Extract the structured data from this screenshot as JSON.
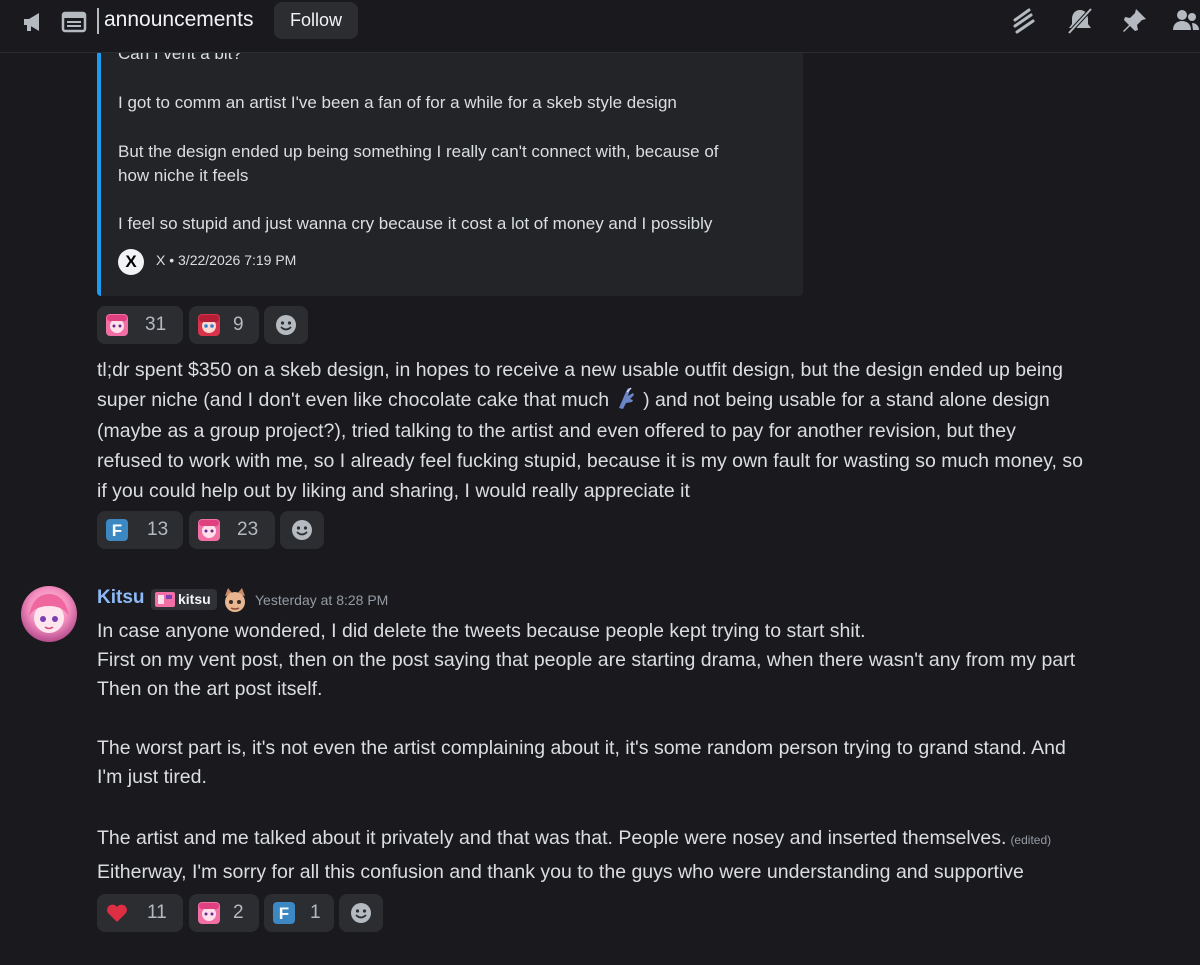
{
  "header": {
    "channel_name": "announcements",
    "follow_label": "Follow"
  },
  "embed": {
    "lines": [
      "Can I vent a bit?",
      "I got to comm an artist I've been a fan of for a while for a skeb style design",
      "But the design ended up being something I really can't connect with, because of",
      "how niche it feels",
      "I feel so stupid and just wanna cry because it cost a lot of money and I possibly"
    ],
    "source_logo": "X",
    "footer": "X • 3/22/2026 7:19 PM",
    "accent_color": "#1d9bf0"
  },
  "reactions_1": [
    {
      "emoji": "pink-anime-girl-emoji",
      "count": "31"
    },
    {
      "emoji": "red-hair-girl-emoji",
      "count": "9"
    }
  ],
  "message_1": {
    "lines": [
      "tl;dr spent $350 on a skeb design, in hopes to receive a new usable outfit design, but the design ended up being",
      "super niche (and I don't even like chocolate cake that much",
      ") and not being usable for a stand alone design",
      "(maybe as a group project?), tried talking to the artist and even offered to pay for another revision, but they",
      "refused to work with me, so I already feel fucking stupid, because it is my own fault for wasting so much money, so",
      "if you could help out by liking and sharing, I would really appreciate it"
    ]
  },
  "reactions_2": [
    {
      "emoji": "blue-f-emoji",
      "label": "F",
      "count": "13"
    },
    {
      "emoji": "pink-anime-girl-emoji",
      "count": "23"
    }
  ],
  "message_2": {
    "username": "Kitsu",
    "role_tag": "kitsu",
    "timestamp": "Yesterday at 8:28 PM",
    "lines": [
      "In case anyone wondered, I did delete the tweets because people kept trying to start shit.",
      "First on my vent post, then on the post saying that people are starting drama, when there wasn't any from my part",
      "Then on the art post itself.",
      "The worst part is, it's not even  the artist complaining about it, it's some random person trying to grand stand. And",
      "I'm just tired.",
      "The artist and me talked about it privately and that was that. People were nosey and inserted themselves.",
      "Eitherway, I'm sorry for all this confusion and thank you to the guys who were understanding and supportive"
    ],
    "edited_label": "(edited)",
    "username_color": "#8eb9f7"
  },
  "reactions_3": [
    {
      "emoji": "red-heart-emoji",
      "count": "11"
    },
    {
      "emoji": "pink-anime-girl-emoji",
      "count": "2"
    },
    {
      "emoji": "blue-f-emoji",
      "label": "F",
      "count": "1"
    }
  ]
}
